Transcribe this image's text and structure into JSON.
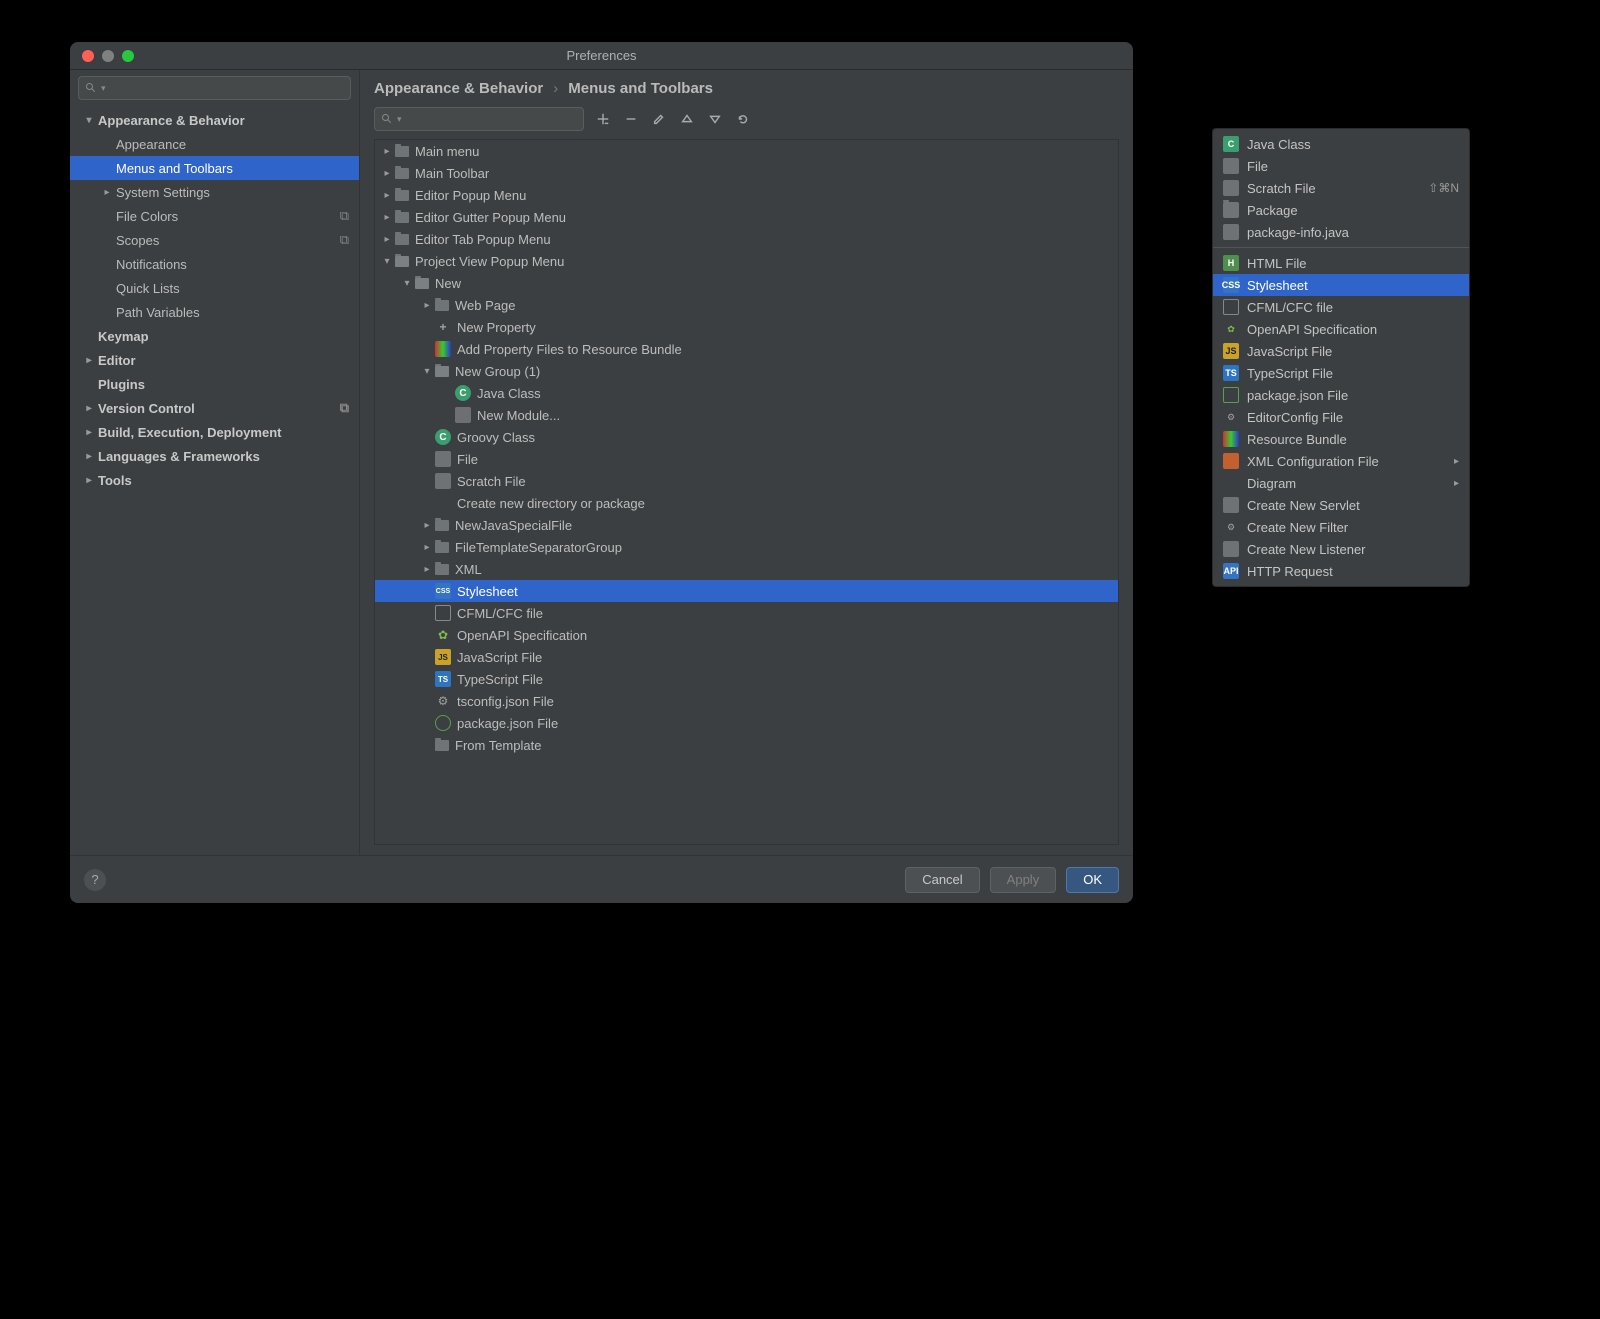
{
  "window": {
    "title": "Preferences"
  },
  "breadcrumb": {
    "group": "Appearance & Behavior",
    "page": "Menus and Toolbars"
  },
  "sidebar": {
    "search_placeholder": "",
    "items": [
      {
        "label": "Appearance & Behavior",
        "lvl": 0,
        "bold": true,
        "arrow": "▾"
      },
      {
        "label": "Appearance",
        "lvl": 1
      },
      {
        "label": "Menus and Toolbars",
        "lvl": 1,
        "selected": true
      },
      {
        "label": "System Settings",
        "lvl": 1,
        "arrow": "▸"
      },
      {
        "label": "File Colors",
        "lvl": 1,
        "trail": "⧉"
      },
      {
        "label": "Scopes",
        "lvl": 1,
        "trail": "⧉"
      },
      {
        "label": "Notifications",
        "lvl": 1
      },
      {
        "label": "Quick Lists",
        "lvl": 1
      },
      {
        "label": "Path Variables",
        "lvl": 1
      },
      {
        "label": "Keymap",
        "lvl": 0,
        "bold": true
      },
      {
        "label": "Editor",
        "lvl": 0,
        "bold": true,
        "arrow": "▸"
      },
      {
        "label": "Plugins",
        "lvl": 0,
        "bold": true
      },
      {
        "label": "Version Control",
        "lvl": 0,
        "bold": true,
        "arrow": "▸",
        "trail": "⧉"
      },
      {
        "label": "Build, Execution, Deployment",
        "lvl": 0,
        "bold": true,
        "arrow": "▸"
      },
      {
        "label": "Languages & Frameworks",
        "lvl": 0,
        "bold": true,
        "arrow": "▸"
      },
      {
        "label": "Tools",
        "lvl": 0,
        "bold": true,
        "arrow": "▸"
      }
    ]
  },
  "tree": [
    {
      "depth": 0,
      "arrow": "▸",
      "icon": "folder",
      "label": "Main menu"
    },
    {
      "depth": 0,
      "arrow": "▸",
      "icon": "folder",
      "label": "Main Toolbar"
    },
    {
      "depth": 0,
      "arrow": "▸",
      "icon": "folder",
      "label": "Editor Popup Menu"
    },
    {
      "depth": 0,
      "arrow": "▸",
      "icon": "folder",
      "label": "Editor Gutter Popup Menu"
    },
    {
      "depth": 0,
      "arrow": "▸",
      "icon": "folder",
      "label": "Editor Tab Popup Menu"
    },
    {
      "depth": 0,
      "arrow": "▾",
      "icon": "folder-open",
      "label": "Project View Popup Menu"
    },
    {
      "depth": 1,
      "arrow": "▾",
      "icon": "folder-open",
      "label": "New"
    },
    {
      "depth": 2,
      "arrow": "▸",
      "icon": "folder",
      "label": "Web Page"
    },
    {
      "depth": 2,
      "arrow": "",
      "icon": "plus",
      "label": "New Property"
    },
    {
      "depth": 2,
      "arrow": "",
      "icon": "bundle",
      "label": "Add Property Files to Resource Bundle"
    },
    {
      "depth": 2,
      "arrow": "▾",
      "icon": "folder-open",
      "label": "New Group (1)"
    },
    {
      "depth": 3,
      "arrow": "",
      "icon": "c",
      "label": "Java Class"
    },
    {
      "depth": 3,
      "arrow": "",
      "icon": "pkg",
      "label": "New Module..."
    },
    {
      "depth": 2,
      "arrow": "",
      "icon": "c",
      "label": "Groovy Class"
    },
    {
      "depth": 2,
      "arrow": "",
      "icon": "file",
      "label": "File"
    },
    {
      "depth": 2,
      "arrow": "",
      "icon": "file",
      "label": "Scratch File"
    },
    {
      "depth": 2,
      "arrow": "",
      "icon": "",
      "label": "Create new directory or package"
    },
    {
      "depth": 2,
      "arrow": "▸",
      "icon": "folder",
      "label": "NewJavaSpecialFile"
    },
    {
      "depth": 2,
      "arrow": "▸",
      "icon": "folder",
      "label": "FileTemplateSeparatorGroup"
    },
    {
      "depth": 2,
      "arrow": "▸",
      "icon": "folder",
      "label": "XML"
    },
    {
      "depth": 2,
      "arrow": "",
      "icon": "css",
      "label": "Stylesheet",
      "selected": true
    },
    {
      "depth": 2,
      "arrow": "",
      "icon": "box",
      "label": "CFML/CFC file"
    },
    {
      "depth": 2,
      "arrow": "",
      "icon": "green",
      "label": "OpenAPI Specification"
    },
    {
      "depth": 2,
      "arrow": "",
      "icon": "js",
      "label": "JavaScript File"
    },
    {
      "depth": 2,
      "arrow": "",
      "icon": "ts",
      "label": "TypeScript File"
    },
    {
      "depth": 2,
      "arrow": "",
      "icon": "gear",
      "label": "tsconfig.json File"
    },
    {
      "depth": 2,
      "arrow": "",
      "icon": "node",
      "label": "package.json File"
    },
    {
      "depth": 2,
      "arrow": "",
      "icon": "folder",
      "label": "From Template"
    }
  ],
  "toolbar": {
    "add": "+",
    "remove": "−",
    "edit": "edit",
    "up": "▲",
    "down": "▼",
    "reset": "⟲"
  },
  "popup": {
    "groups": [
      [
        {
          "icon": "c",
          "label": "Java Class"
        },
        {
          "icon": "file",
          "label": "File"
        },
        {
          "icon": "file",
          "label": "Scratch File",
          "shortcut": "⇧⌘N"
        },
        {
          "icon": "folder",
          "label": "Package"
        },
        {
          "icon": "file",
          "label": "package-info.java"
        }
      ],
      [
        {
          "icon": "html",
          "label": "HTML File"
        },
        {
          "icon": "css",
          "label": "Stylesheet",
          "selected": true
        },
        {
          "icon": "box",
          "label": "CFML/CFC file"
        },
        {
          "icon": "green",
          "label": "OpenAPI Specification"
        },
        {
          "icon": "js",
          "label": "JavaScript File"
        },
        {
          "icon": "ts",
          "label": "TypeScript File"
        },
        {
          "icon": "node",
          "label": "package.json File"
        },
        {
          "icon": "gear",
          "label": "EditorConfig File"
        },
        {
          "icon": "bundle",
          "label": "Resource Bundle"
        },
        {
          "icon": "xmlcfg",
          "label": "XML Configuration File",
          "submenu": true
        },
        {
          "icon": "",
          "label": "Diagram",
          "submenu": true
        },
        {
          "icon": "file",
          "label": "Create New Servlet"
        },
        {
          "icon": "gear",
          "label": "Create New Filter"
        },
        {
          "icon": "file",
          "label": "Create New Listener"
        },
        {
          "icon": "api",
          "label": "HTTP Request"
        }
      ]
    ]
  },
  "footer": {
    "help": "?",
    "cancel": "Cancel",
    "apply": "Apply",
    "ok": "OK"
  }
}
